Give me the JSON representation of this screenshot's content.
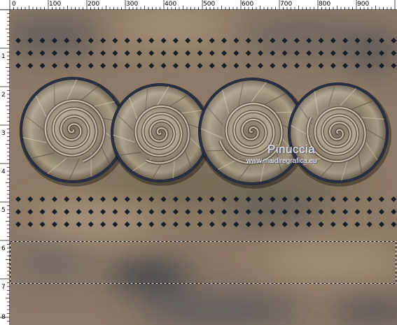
{
  "ruler": {
    "h_labels": [
      "0",
      "100",
      "200",
      "300",
      "400",
      "500",
      "600",
      "700",
      "800",
      "900"
    ],
    "v_labels": [
      "1",
      "2",
      "3",
      "4",
      "5",
      "6",
      "7",
      "8"
    ]
  },
  "watermark": {
    "name": "Pinuccia",
    "url": "www.maidiregrafica.eu"
  },
  "colors": {
    "background_base": "#8e7b66",
    "dark_cloud": "#3d4250",
    "tile_frame": "#1a1e2e",
    "tile_metal": "#8d826f",
    "diamond": "#1b1d24",
    "selection_marquee": "#000000"
  },
  "canvas": {
    "circle_tiles": 4,
    "diamond_bands": 2,
    "selection_active": true
  }
}
